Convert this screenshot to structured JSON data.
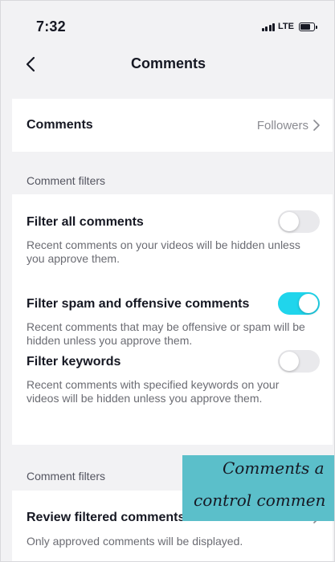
{
  "status_bar": {
    "time": "7:32",
    "network": "LTE"
  },
  "nav": {
    "title": "Comments",
    "back_icon": "chevron-left-icon"
  },
  "comments_setting": {
    "label": "Comments",
    "value": "Followers"
  },
  "section_headers": [
    "Comment filters",
    "Comment filters"
  ],
  "filters": [
    {
      "title": "Filter all comments",
      "description": "Recent comments on your videos will be hidden unless you approve them.",
      "enabled": false
    },
    {
      "title": "Filter spam and offensive comments",
      "description": "Recent comments that may be offensive or spam will be hidden unless you approve them.",
      "enabled": true
    },
    {
      "title": "Filter keywords",
      "description": "Recent comments with specified keywords on your videos will be hidden unless you approve them.",
      "enabled": false
    }
  ],
  "review": {
    "title": "Review filtered comments",
    "description": "Only approved comments will be displayed."
  },
  "caption": {
    "line1": "Comments a",
    "line2": "control commen"
  },
  "colors": {
    "accent": "#20d5ec",
    "background": "#f2f2f4",
    "caption_bg": "#5bbfca"
  }
}
